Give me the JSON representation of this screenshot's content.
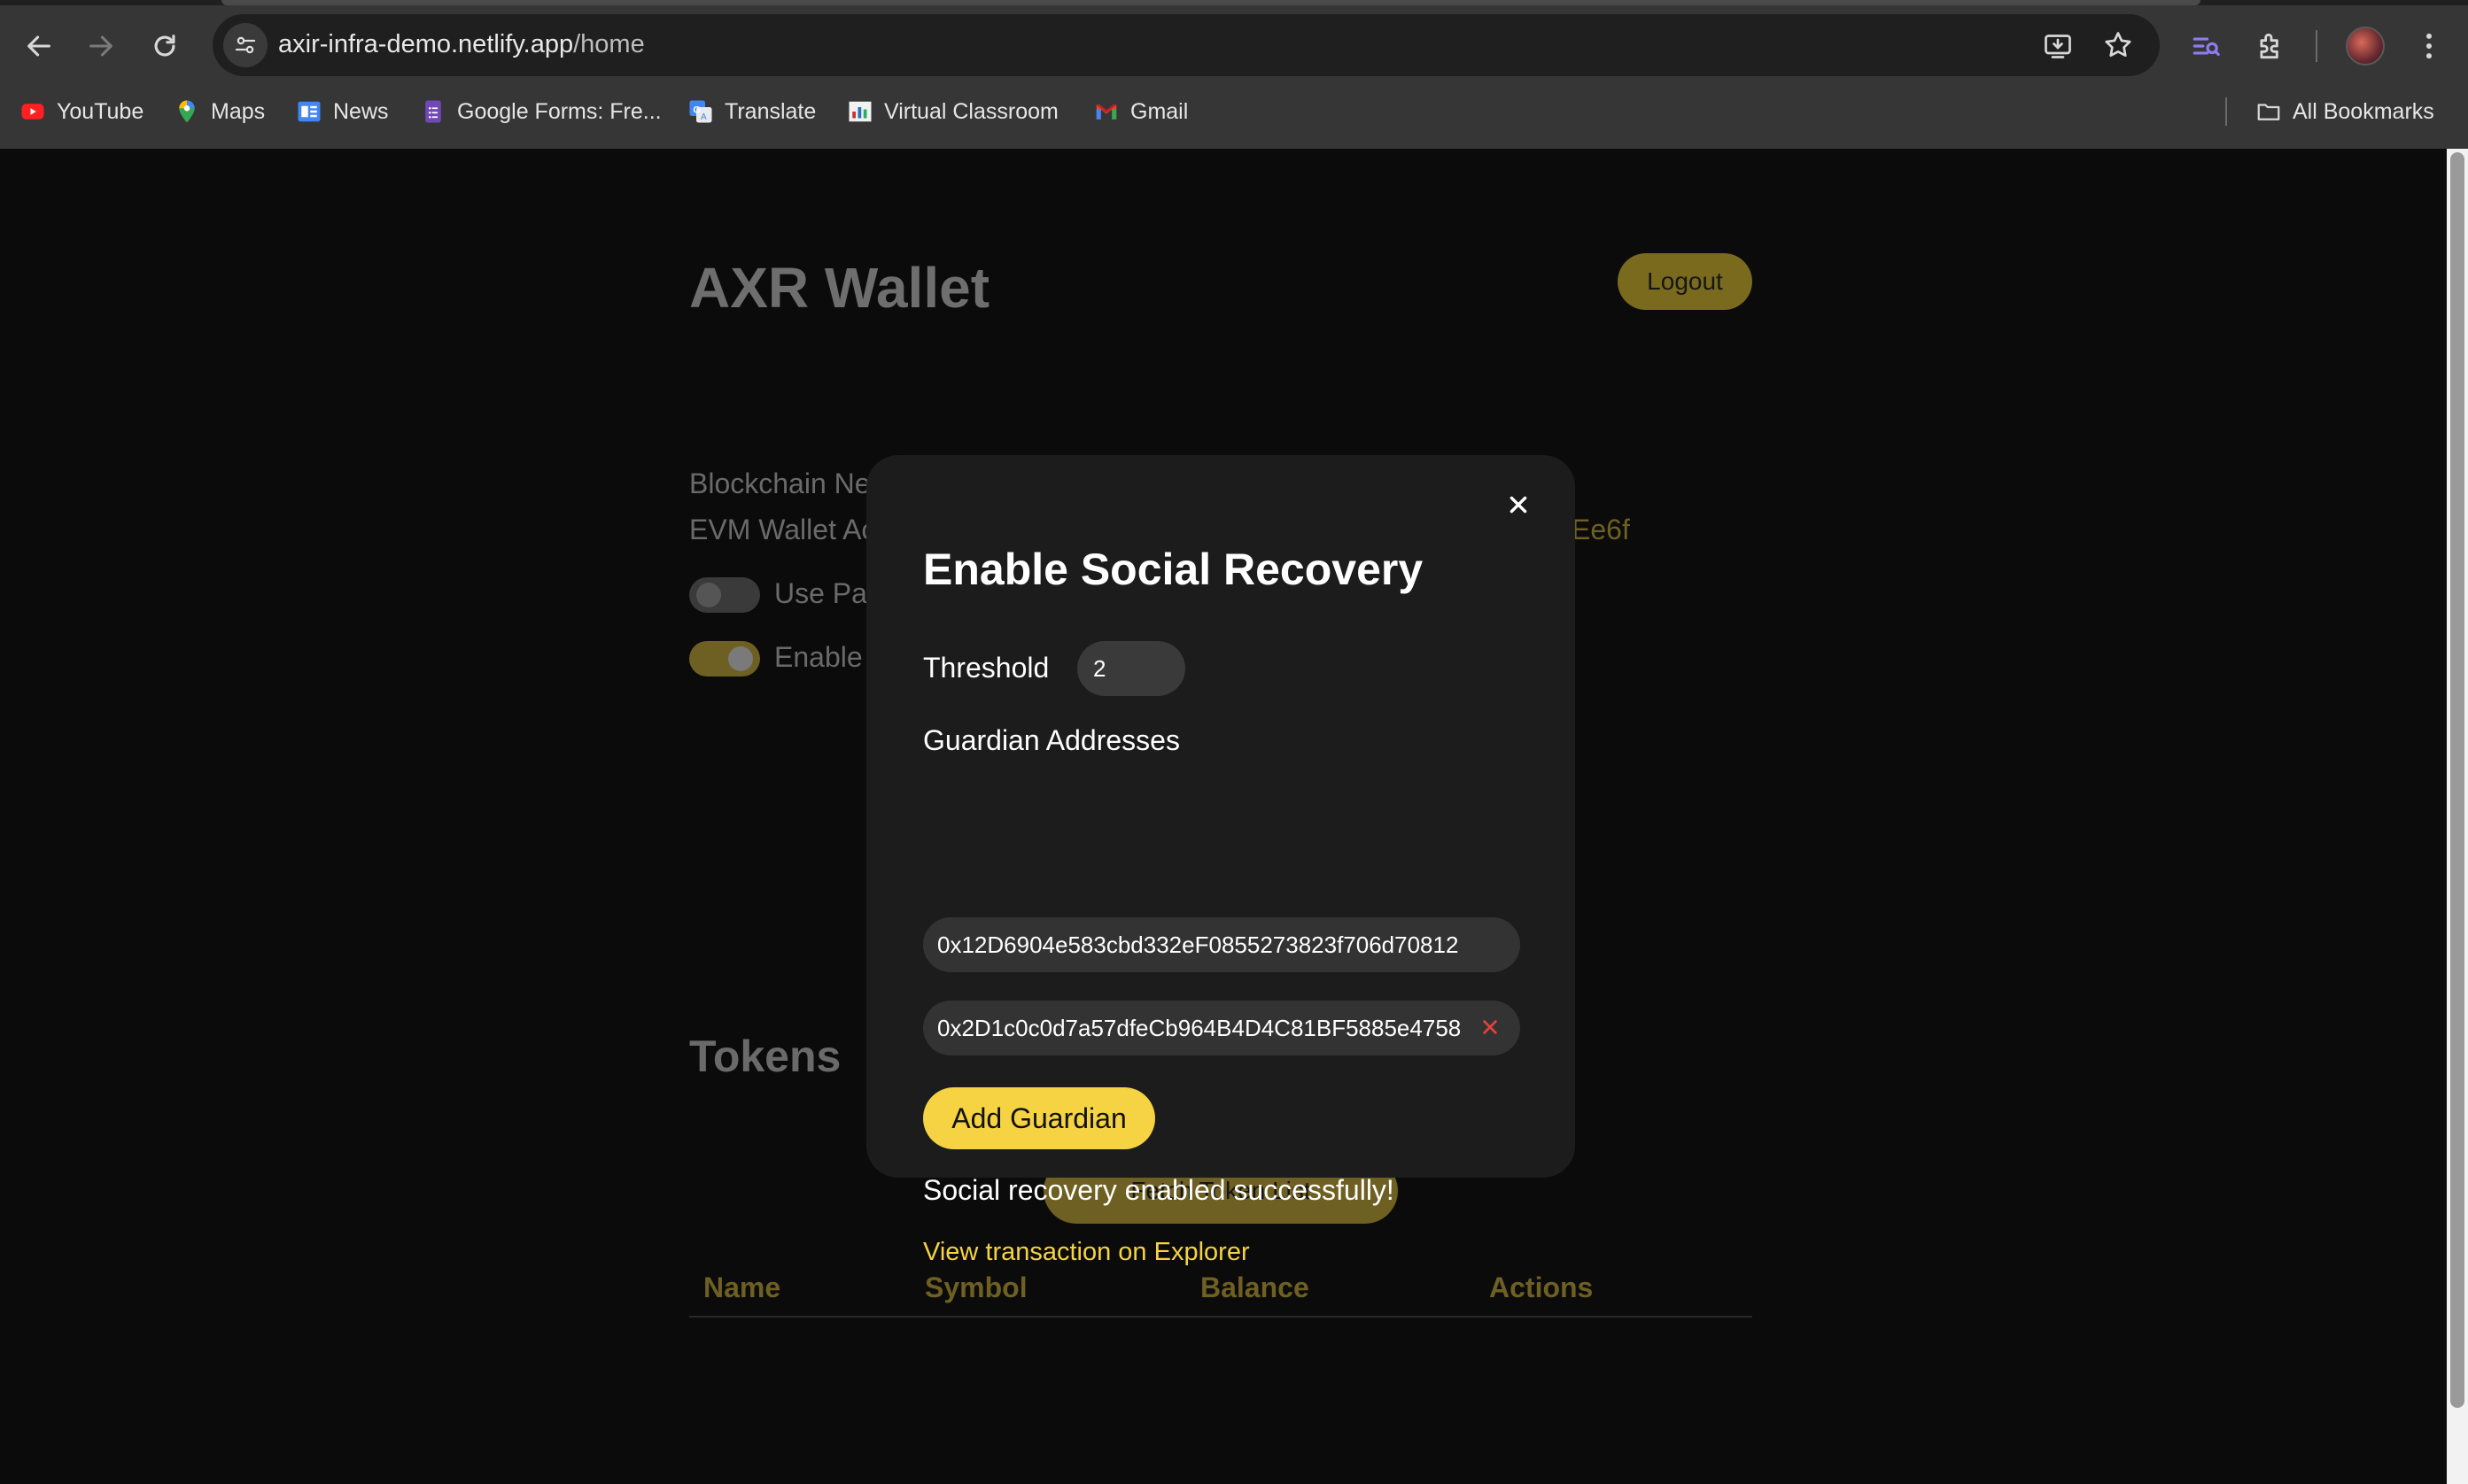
{
  "browser": {
    "url_host": "axir-infra-demo.netlify.app",
    "url_path": "/home",
    "bookmarks": [
      {
        "label": "YouTube",
        "icon": "youtube-icon"
      },
      {
        "label": "Maps",
        "icon": "maps-icon"
      },
      {
        "label": "News",
        "icon": "news-icon"
      },
      {
        "label": "Google Forms: Fre...",
        "icon": "forms-icon"
      },
      {
        "label": "Translate",
        "icon": "translate-icon"
      },
      {
        "label": "Virtual Classroom",
        "icon": "classroom-icon"
      },
      {
        "label": "Gmail",
        "icon": "gmail-icon"
      }
    ],
    "all_bookmarks_label": "All Bookmarks"
  },
  "app": {
    "title": "AXR Wallet",
    "logout_label": "Logout",
    "blockchain_line": "Blockchain Ne",
    "evm_line": "EVM Wallet Ac",
    "evm_address_tail": "Ee6f",
    "toggle_paymaster_label": "Use Pa",
    "toggle_paymaster_on": false,
    "toggle_enable_label": "Enable",
    "toggle_enable_on": true,
    "tokens_title": "Tokens",
    "fetch_tokens_label": "Fetch Token List",
    "table_headers": [
      "Name",
      "Symbol",
      "Balance",
      "Actions"
    ]
  },
  "modal": {
    "title": "Enable Social Recovery",
    "threshold_label": "Threshold",
    "threshold_value": "2",
    "guardians_label": "Guardian Addresses",
    "guardians": [
      "0x12D6904e583cbd332eF0855273823f706d70812",
      "0x2D1c0c0d7a57dfeCb964B4D4C81BF5885e4758"
    ],
    "add_guardian_label": "Add Guardian",
    "status_message": "Social recovery enabled successfully!",
    "explorer_link_label": "View transaction on Explorer"
  },
  "colors": {
    "accent": "#f5d343",
    "accent_dimmed": "#6e5f22",
    "remove_red": "#e0443a"
  }
}
